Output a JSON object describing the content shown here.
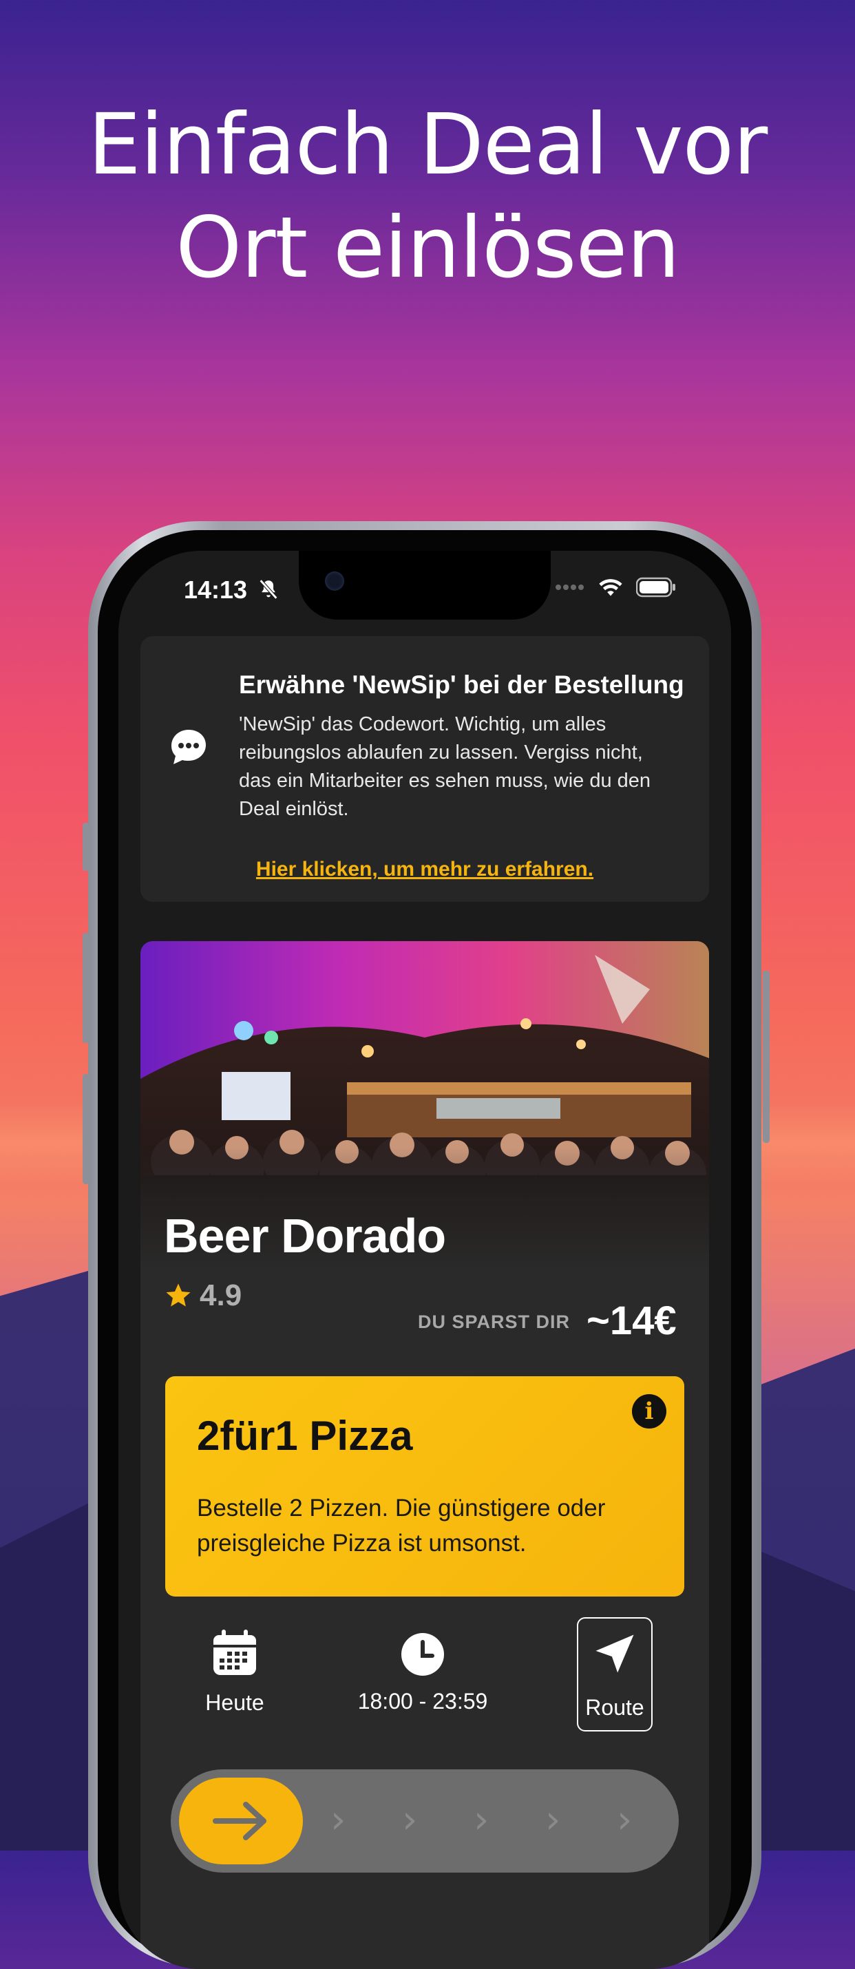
{
  "headline": {
    "line1": "Einfach Deal vor",
    "line2": "Ort einlösen"
  },
  "status_bar": {
    "time": "14:13"
  },
  "notice": {
    "title": "Erwähne 'NewSip' bei der Bestellung",
    "body": "'NewSip' das Codewort. Wichtig, um alles reibungslos ablaufen zu lassen. Vergiss nicht, das ein Mitarbeiter es sehen muss, wie du den Deal einlöst.",
    "link": "Hier klicken, um mehr zu erfahren."
  },
  "venue": {
    "name": "Beer Dorado",
    "rating": "4.9",
    "savings_label": "DU SPARST DIR",
    "savings_value": "~14€"
  },
  "deal": {
    "title": "2für1 Pizza",
    "text": "Bestelle 2 Pizzen. Die günstigere oder preisgleiche Pizza ist umsonst."
  },
  "meta": {
    "day": "Heute",
    "hours": "18:00 - 23:59",
    "route_label": "Route"
  },
  "colors": {
    "accent": "#f6b40c",
    "card": "#262626",
    "screen": "#1b1b1c"
  }
}
